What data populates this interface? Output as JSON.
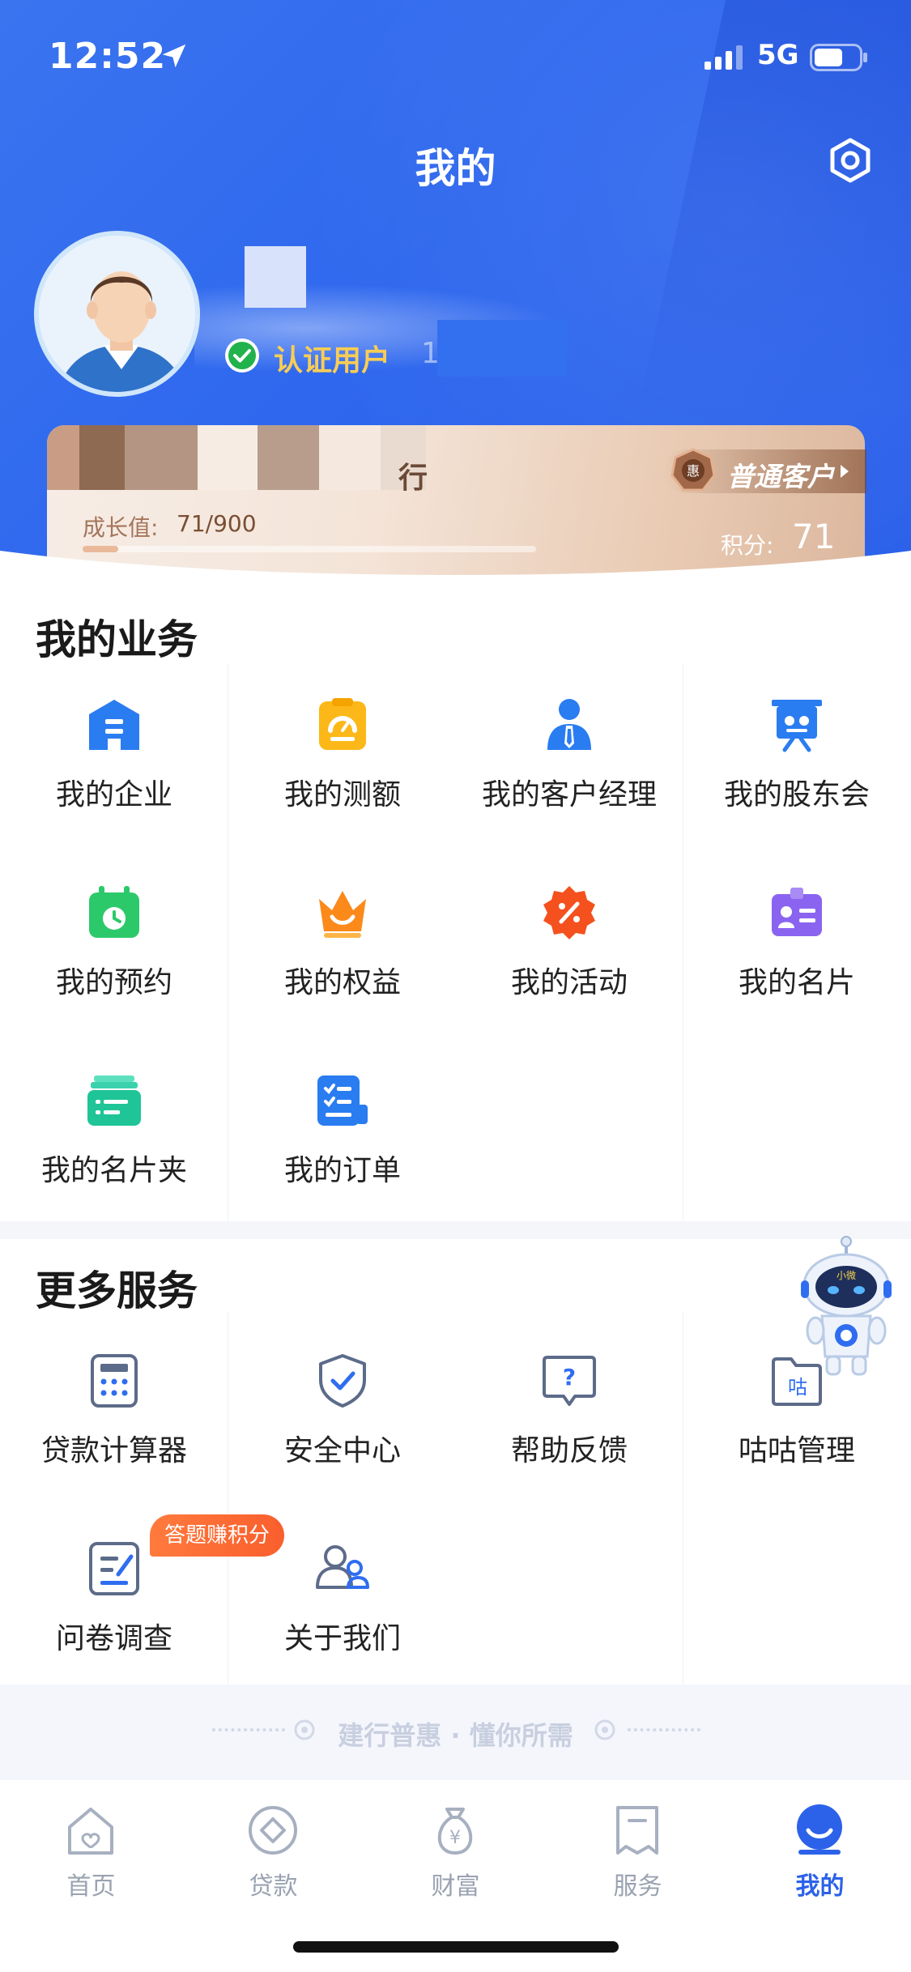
{
  "status_bar": {
    "time": "12:52",
    "network": "5G"
  },
  "header": {
    "title": "我的"
  },
  "profile": {
    "verified_label": "认证用户",
    "phone_prefix": "1"
  },
  "member_card": {
    "bank_name_suffix": "行",
    "growth_label": "成长值:",
    "growth_value": "71/900",
    "growth_progress_fraction": 0.079,
    "level_label": "普通客户",
    "points_label": "积分:",
    "points_value": "71"
  },
  "my_business": {
    "title": "我的业务",
    "items": [
      {
        "label": "我的企业",
        "icon": "enterprise-icon"
      },
      {
        "label": "我的测额",
        "icon": "quota-icon"
      },
      {
        "label": "我的客户经理",
        "icon": "manager-icon"
      },
      {
        "label": "我的股东会",
        "icon": "shareholder-icon"
      },
      {
        "label": "我的预约",
        "icon": "calendar-icon"
      },
      {
        "label": "我的权益",
        "icon": "crown-icon"
      },
      {
        "label": "我的活动",
        "icon": "discount-icon"
      },
      {
        "label": "我的名片",
        "icon": "id-card-icon"
      },
      {
        "label": "我的名片夹",
        "icon": "card-holder-icon"
      },
      {
        "label": "我的订单",
        "icon": "order-icon"
      }
    ]
  },
  "more_services": {
    "title": "更多服务",
    "items": [
      {
        "label": "贷款计算器",
        "icon": "calculator-icon"
      },
      {
        "label": "安全中心",
        "icon": "shield-icon"
      },
      {
        "label": "帮助反馈",
        "icon": "help-icon"
      },
      {
        "label": "咕咕管理",
        "icon": "gugu-folder-icon",
        "glyph": "咕"
      },
      {
        "label": "问卷调查",
        "icon": "survey-icon"
      },
      {
        "label": "关于我们",
        "icon": "about-icon"
      }
    ],
    "quiz_badge": "答题赚积分",
    "robot_label": "小微"
  },
  "slogan": "建行普惠 · 懂你所需",
  "tabbar": {
    "items": [
      {
        "label": "首页",
        "icon": "home-icon"
      },
      {
        "label": "贷款",
        "icon": "loan-icon"
      },
      {
        "label": "财富",
        "icon": "wealth-icon",
        "glyph": "¥"
      },
      {
        "label": "服务",
        "icon": "service-icon"
      },
      {
        "label": "我的",
        "icon": "profile-icon"
      }
    ],
    "active": "我的"
  },
  "colors": {
    "primary": "#2f68ee",
    "accent_gold": "#f9cd55",
    "tab_active": "#2c62e9",
    "badge_orange": "#f95f2d"
  }
}
